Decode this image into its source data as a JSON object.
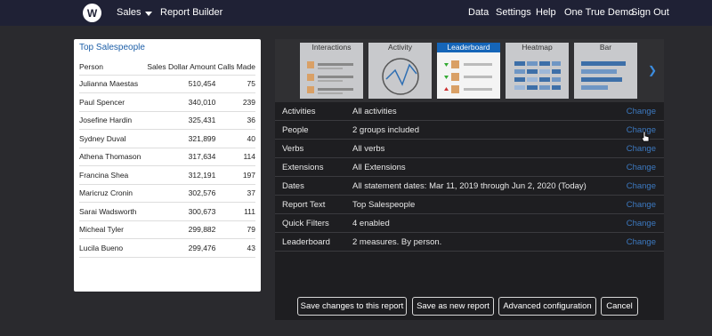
{
  "nav": {
    "logo": "W",
    "app": "Sales",
    "report_builder": "Report Builder",
    "links": [
      "Data",
      "Settings",
      "Help",
      "One True Demo",
      "Sign Out"
    ]
  },
  "leaderboard": {
    "title": "Top Salespeople",
    "columns": [
      "Person",
      "Sales Dollar Amount",
      "Calls Made"
    ],
    "rows": [
      [
        "Julianna Maestas",
        "510,454",
        "75"
      ],
      [
        "Paul Spencer",
        "340,010",
        "239"
      ],
      [
        "Josefine Hardin",
        "325,431",
        "36"
      ],
      [
        "Sydney Duval",
        "321,899",
        "40"
      ],
      [
        "Athena Thomason",
        "317,634",
        "114"
      ],
      [
        "Francina Shea",
        "312,191",
        "197"
      ],
      [
        "Maricruz Cronin",
        "302,576",
        "37"
      ],
      [
        "Sarai Wadsworth",
        "300,673",
        "111"
      ],
      [
        "Micheal Tyler",
        "299,882",
        "79"
      ],
      [
        "Lucila Bueno",
        "299,476",
        "43"
      ]
    ]
  },
  "thumbnails": [
    "Interactions",
    "Activity",
    "Leaderboard",
    "Heatmap",
    "Bar"
  ],
  "settings": [
    {
      "label": "Activities",
      "value": "All activities",
      "action": "Change"
    },
    {
      "label": "People",
      "value": "2 groups included",
      "action": "Change"
    },
    {
      "label": "Verbs",
      "value": "All verbs",
      "action": "Change"
    },
    {
      "label": "Extensions",
      "value": "All Extensions",
      "action": "Change"
    },
    {
      "label": "Dates",
      "value": "All statement dates: Mar 11, 2019 through Jun 2, 2020 (Today)",
      "action": "Change"
    },
    {
      "label": "Report Text",
      "value": "Top Salespeople",
      "action": "Change"
    },
    {
      "label": "Quick Filters",
      "value": "4 enabled",
      "action": "Change"
    },
    {
      "label": "Leaderboard",
      "value": "2 measures. By person.",
      "action": "Change"
    }
  ],
  "buttons": {
    "save_changes": "Save changes to this report",
    "save_new": "Save as new report",
    "advanced": "Advanced configuration",
    "cancel": "Cancel"
  }
}
